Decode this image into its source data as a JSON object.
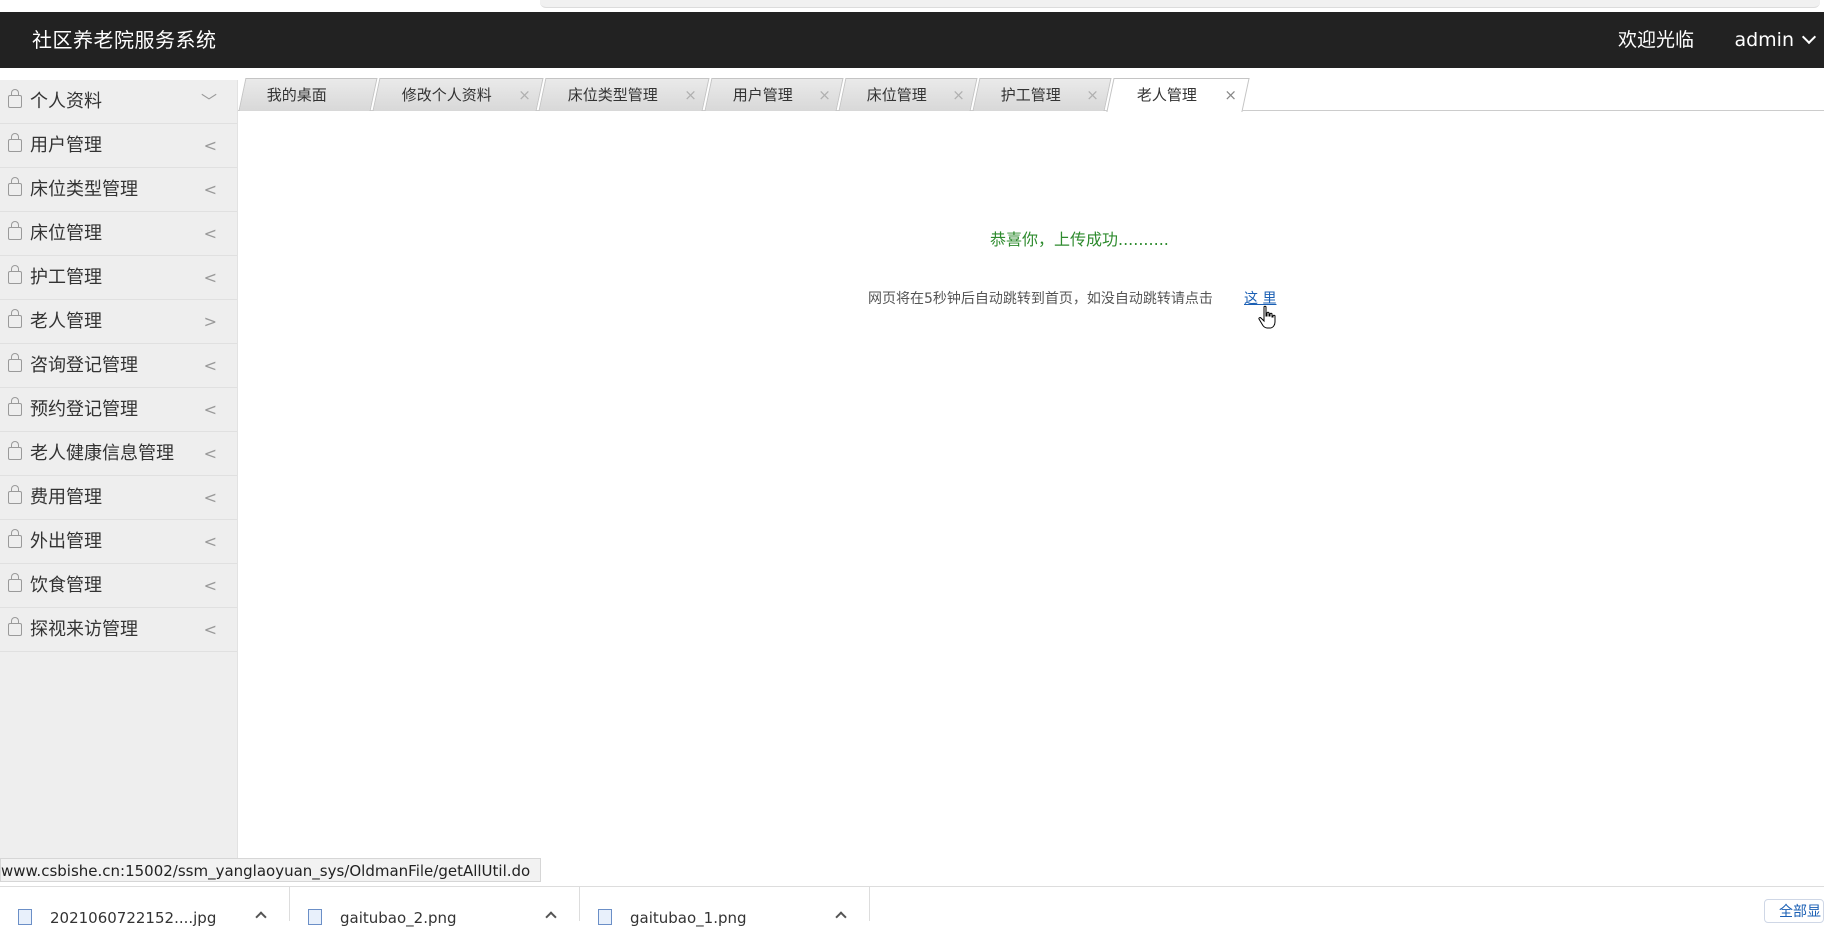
{
  "header": {
    "title": "社区养老院服务系统",
    "welcome": "欢迎光临",
    "user": "admin"
  },
  "sidebar": {
    "items": [
      {
        "label": "个人资料",
        "arrow": "﹀"
      },
      {
        "label": "用户管理",
        "arrow": "<"
      },
      {
        "label": "床位类型管理",
        "arrow": "<"
      },
      {
        "label": "床位管理",
        "arrow": "<"
      },
      {
        "label": "护工管理",
        "arrow": "<"
      },
      {
        "label": "老人管理",
        "arrow": ">"
      },
      {
        "label": "咨询登记管理",
        "arrow": "<"
      },
      {
        "label": "预约登记管理",
        "arrow": "<"
      },
      {
        "label": "老人健康信息管理",
        "arrow": "<"
      },
      {
        "label": "费用管理",
        "arrow": "<"
      },
      {
        "label": "外出管理",
        "arrow": "<"
      },
      {
        "label": "饮食管理",
        "arrow": "<"
      },
      {
        "label": "探视来访管理",
        "arrow": "<"
      }
    ]
  },
  "tabs": [
    {
      "label": "我的桌面",
      "close": ""
    },
    {
      "label": "修改个人资料",
      "close": "×"
    },
    {
      "label": "床位类型管理",
      "close": "×"
    },
    {
      "label": "用户管理",
      "close": "×"
    },
    {
      "label": "床位管理",
      "close": "×"
    },
    {
      "label": "护工管理",
      "close": "×"
    },
    {
      "label": "老人管理",
      "close": "×"
    }
  ],
  "main": {
    "success": "恭喜你，上传成功..........",
    "redirect": "网页将在5秒钟后自动跳转到首页，如没自动跳转请点击",
    "link": "这 里"
  },
  "status": {
    "url": "www.csbishe.cn:15002/ssm_yanglaoyuan_sys/OldmanFile/getAllUtil.do"
  },
  "downloads": [
    {
      "name": "2021060722152....jpg"
    },
    {
      "name": "gaitubao_2.png"
    },
    {
      "name": "gaitubao_1.png"
    }
  ],
  "show_all": "全部显示"
}
